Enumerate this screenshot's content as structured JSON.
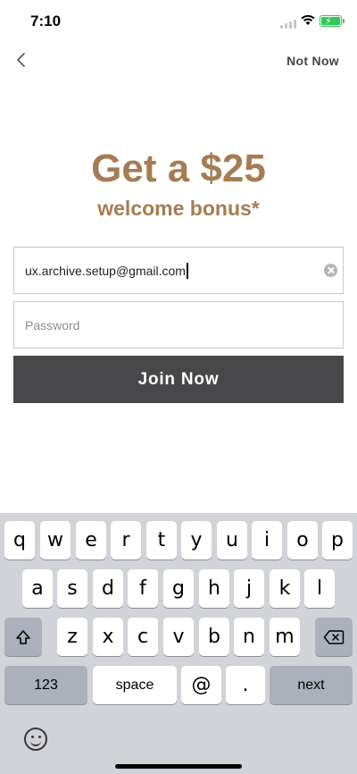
{
  "status": {
    "time": "7:10"
  },
  "nav": {
    "not_now": "Not Now"
  },
  "hero": {
    "title": "Get a $25",
    "subtitle": "welcome bonus*"
  },
  "form": {
    "email_value": "ux.archive.setup@gmail.com",
    "password_placeholder": "Password",
    "join_label": "Join Now"
  },
  "keyboard": {
    "row1": [
      "q",
      "w",
      "e",
      "r",
      "t",
      "y",
      "u",
      "i",
      "o",
      "p"
    ],
    "row2": [
      "a",
      "s",
      "d",
      "f",
      "g",
      "h",
      "j",
      "k",
      "l"
    ],
    "row3": [
      "z",
      "x",
      "c",
      "v",
      "b",
      "n",
      "m"
    ],
    "numbers_label": "123",
    "space_label": "space",
    "at_label": "@",
    "period_label": ".",
    "next_label": "next"
  },
  "colors": {
    "brand": "#a67c52",
    "button": "#48484a",
    "battery": "#34c759"
  }
}
